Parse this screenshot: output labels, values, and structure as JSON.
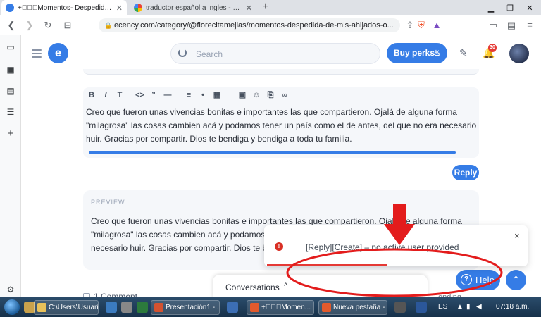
{
  "browser": {
    "tabs": [
      {
        "title": "+⃝⃝⃝Momentos- Despedida de",
        "close": "✕",
        "active": true
      },
      {
        "title": "traductor español a ingles - Buscar co",
        "close": "✕",
        "active": false
      }
    ],
    "new_tab": "+",
    "url": "ecency.com/category/@florecitamejias/momentos-despedida-de-mis-ahijados-o..."
  },
  "header": {
    "search_placeholder": "Search",
    "buy_perks_label": "Buy perks",
    "notification_count": "30"
  },
  "editor": {
    "toolbar": [
      "B",
      "I",
      "T",
      "<>",
      "”",
      "—",
      "≡",
      "•",
      "▦",
      "▣",
      "☺",
      "⎘",
      "∞"
    ],
    "text": "Creo que fueron unas vivencias bonitas e importantes las que compartieron. Ojalá de alguna forma \"milagrosa\" las cosas cambien acá y podamos tener un país como el de antes, del que no era necesario huir. Gracias por compartir. Dios te bendiga y bendiga a toda tu familia."
  },
  "reply_button": "Reply",
  "preview": {
    "label": "PREVIEW",
    "text": "Creo que fueron unas vivencias bonitas e importantes las que compartieron. Ojalá de alguna forma \"milagrosa\" las cosas cambien acá y podamos tener un país como el de antes, del que no era necesario huir. Gracias por compartir. Dios te bendiga y bendiga a toda tu familia."
  },
  "comments_label": "1 Comment",
  "trending_label": "ending",
  "conversations": {
    "label": "Conversations",
    "chevron": "^"
  },
  "help_label": "Help",
  "toast": {
    "message": "[Reply][Create] – no active user provided",
    "icon": "!",
    "close": "×"
  },
  "taskbar": {
    "tasks": [
      {
        "label": "C:\\Users\\Usuari...",
        "color": "#e8c15a"
      },
      {
        "label": "Presentación1 - ...",
        "color": "#d35230"
      },
      {
        "label": "+⃝⃝⃝Momen...",
        "color": "#e25a2c"
      },
      {
        "label": "Nueva pestaña - ...",
        "color": "#e25a2c"
      }
    ],
    "lang": "ES",
    "time": "07:18 a.m."
  },
  "colors": {
    "accent": "#357ce6",
    "error": "#d93025",
    "annotation": "#e31c1c"
  }
}
